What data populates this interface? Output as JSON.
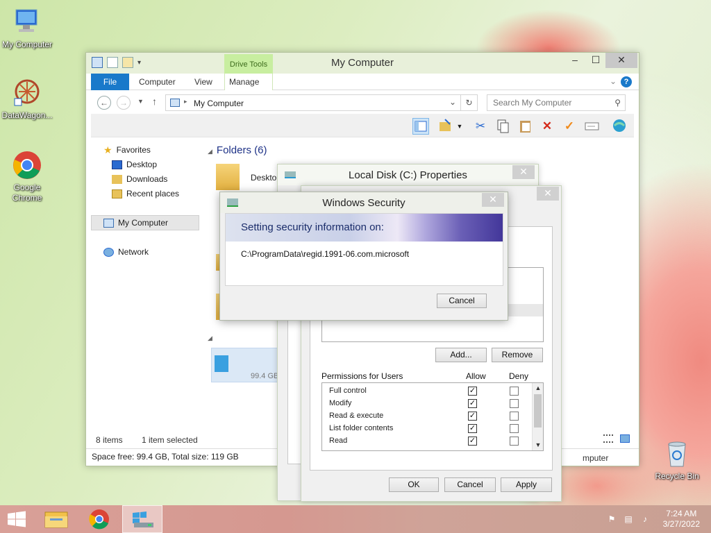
{
  "desktop": {
    "icons": [
      {
        "label": "My Computer"
      },
      {
        "label": "DataWagon..."
      },
      {
        "label": "Google Chrome"
      },
      {
        "label": "Recycle Bin"
      }
    ]
  },
  "explorer": {
    "title": "My Computer",
    "contextual_tab": "Drive Tools",
    "tabs": [
      "File",
      "Computer",
      "View",
      "Manage"
    ],
    "address": "My Computer",
    "search_placeholder": "Search My Computer",
    "nav": {
      "favorites": "Favorites",
      "desktop": "Desktop",
      "downloads": "Downloads",
      "recent": "Recent places",
      "my_computer": "My Computer",
      "network": "Network"
    },
    "group_folders": "Folders (6)",
    "folder_desktop": "Desktop",
    "drive_size_fragment": "99.4 GB",
    "items_count": "8 items",
    "selection": "1 item selected",
    "space_info": "Space free: 99.4 GB, Total size: 119 GB",
    "status_right": "mputer"
  },
  "props_back": {
    "title": "Local Disk (C:) Properties"
  },
  "props_front": {
    "add_label": "Add...",
    "remove_label": "Remove",
    "permissions_label": "Permissions for Users",
    "allow_label": "Allow",
    "deny_label": "Deny",
    "permissions": [
      {
        "name": "Full control",
        "allow": true,
        "deny": false
      },
      {
        "name": "Modify",
        "allow": true,
        "deny": false
      },
      {
        "name": "Read & execute",
        "allow": true,
        "deny": false
      },
      {
        "name": "List folder contents",
        "allow": true,
        "deny": false
      },
      {
        "name": "Read",
        "allow": true,
        "deny": false
      }
    ],
    "ok_label": "OK",
    "cancel_label": "Cancel",
    "apply_label": "Apply"
  },
  "security_dialog": {
    "title": "Windows Security",
    "heading": "Setting security information on:",
    "path": "C:\\ProgramData\\regid.1991-06.com.microsoft",
    "cancel_label": "Cancel"
  },
  "taskbar": {
    "time": "7:24 AM",
    "date": "3/27/2022"
  }
}
